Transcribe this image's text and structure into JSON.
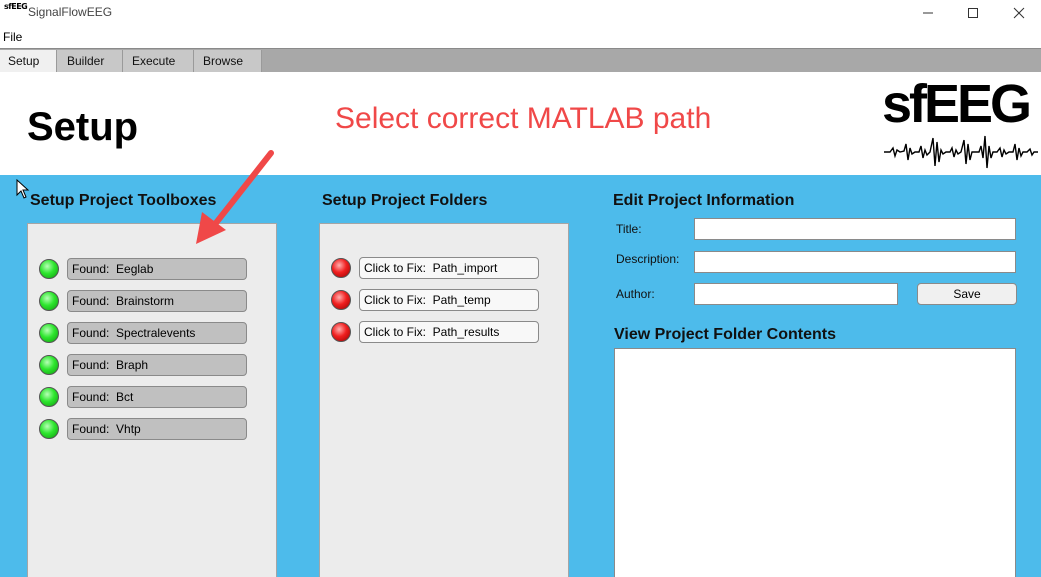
{
  "window": {
    "title": "SignalFlowEEG",
    "icon_text": "sfEEG",
    "minimize_icon": "minimize-icon",
    "maximize_icon": "maximize-icon",
    "close_icon": "close-icon"
  },
  "menu": {
    "file": "File"
  },
  "tabs": [
    {
      "label": "Setup",
      "active": true
    },
    {
      "label": "Builder",
      "active": false
    },
    {
      "label": "Execute",
      "active": false
    },
    {
      "label": "Browse",
      "active": false
    }
  ],
  "header": {
    "title": "Setup",
    "message": "Select correct MATLAB path",
    "message_color": "#f04848",
    "logo_text": "sfEEG"
  },
  "toolboxes": {
    "title": "Setup Project Toolboxes",
    "items": [
      {
        "status": "green",
        "label": "Found:  Eeglab"
      },
      {
        "status": "green",
        "label": "Found:  Brainstorm"
      },
      {
        "status": "green",
        "label": "Found:  Spectralevents"
      },
      {
        "status": "green",
        "label": "Found:  Braph"
      },
      {
        "status": "green",
        "label": "Found:  Bct"
      },
      {
        "status": "green",
        "label": "Found:  Vhtp"
      }
    ]
  },
  "folders": {
    "title": "Setup Project Folders",
    "items": [
      {
        "status": "red",
        "label": "Click to Fix:  Path_import"
      },
      {
        "status": "red",
        "label": "Click to Fix:  Path_temp"
      },
      {
        "status": "red",
        "label": "Click to Fix:  Path_results"
      }
    ]
  },
  "project_info": {
    "title": "Edit Project Information",
    "title_label": "Title:",
    "title_value": "",
    "description_label": "Description:",
    "description_value": "",
    "author_label": "Author:",
    "author_value": "",
    "save_label": "Save"
  },
  "folder_contents": {
    "title": "View Project Folder Contents"
  },
  "colors": {
    "main_background": "#4dbbeb",
    "panel_background": "#ececec",
    "annotation_arrow": "#f04848",
    "status_found": "#2ee62e",
    "status_missing": "#f02020"
  }
}
